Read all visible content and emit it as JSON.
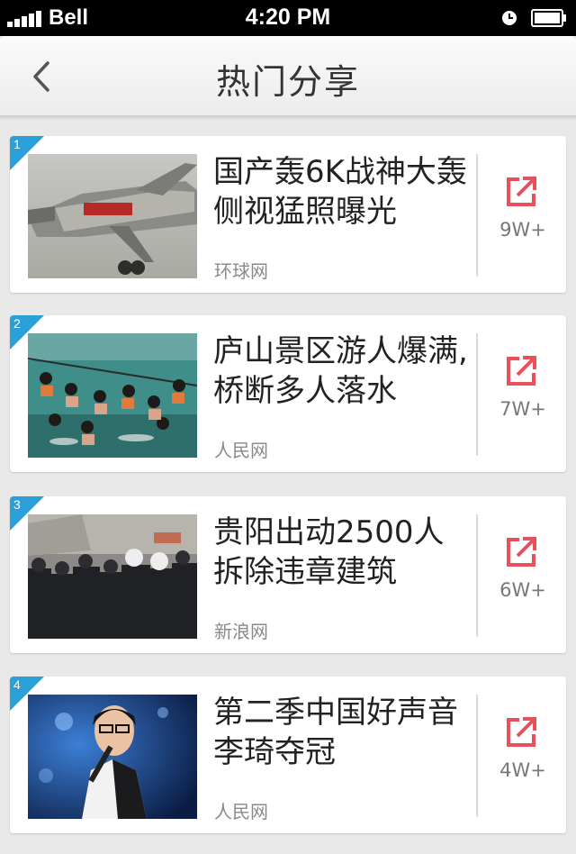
{
  "status_bar": {
    "carrier": "Bell",
    "time": "4:20 PM"
  },
  "nav": {
    "title": "热门分享",
    "back_icon": "chevron-left-icon"
  },
  "colors": {
    "rank_badge": "#2a9fd8",
    "share_accent": "#e8515b"
  },
  "items": [
    {
      "rank": "1",
      "title": "国产轰6K战神大轰侧视猛照曝光",
      "source": "环球网",
      "share_count": "9W+",
      "image": "military-bomber-photo"
    },
    {
      "rank": "2",
      "title": "庐山景区游人爆满,桥断多人落水",
      "source": "人民网",
      "share_count": "7W+",
      "image": "people-in-water-photo"
    },
    {
      "rank": "3",
      "title": "贵阳出动2500人拆除违章建筑",
      "source": "新浪网",
      "share_count": "6W+",
      "image": "police-crowd-photo"
    },
    {
      "rank": "4",
      "title": "第二季中国好声音李琦夺冠",
      "source": "人民网",
      "share_count": "4W+",
      "image": "singer-on-stage-photo"
    }
  ]
}
